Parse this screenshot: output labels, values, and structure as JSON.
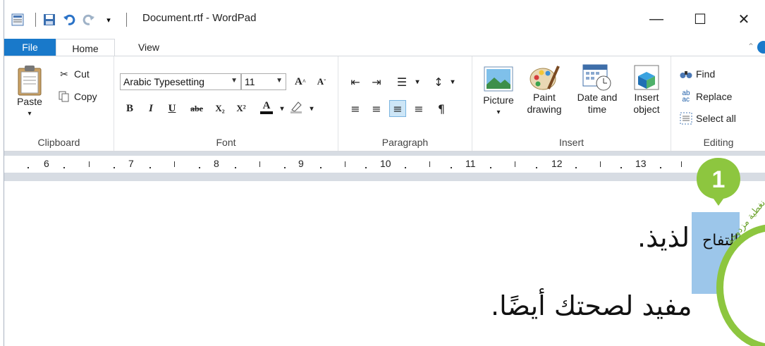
{
  "window": {
    "title": "Document.rtf - WordPad",
    "controls": {
      "minimize": "—",
      "maximize": "☐",
      "close": "✕"
    }
  },
  "tabs": [
    {
      "label": "File"
    },
    {
      "label": "Home"
    },
    {
      "label": "View"
    }
  ],
  "ribbon": {
    "clipboard": {
      "label": "Clipboard",
      "paste": "Paste",
      "cut": "Cut",
      "copy": "Copy"
    },
    "font": {
      "label": "Font",
      "family": "Arabic Typesetting",
      "size": "11",
      "bold": "B",
      "italic": "I",
      "underline": "U",
      "strike": "abe",
      "subscript": "X₂",
      "superscript": "X²"
    },
    "paragraph": {
      "label": "Paragraph"
    },
    "insert": {
      "label": "Insert",
      "picture": "Picture",
      "paint_drawing": "Paint drawing",
      "date_time": "Date and time",
      "insert_object": "Insert object"
    },
    "editing": {
      "label": "Editing",
      "find": "Find",
      "replace": "Replace",
      "select_all": "Select all"
    }
  },
  "ruler": {
    "numbers": [
      "6",
      "7",
      "8",
      "9",
      "10",
      "11",
      "12",
      "13"
    ]
  },
  "document": {
    "selected_word": "التفاح",
    "line1_rest": "لذيذ.",
    "line2": "مفيد لصحتك أيضًا."
  },
  "callout": {
    "number": "1",
    "color": "#8dc63f"
  },
  "sticker": {
    "text": "نغطية مزدوجة"
  },
  "colors": {
    "file_tab": "#1979ca",
    "selection": "#9cc6ea",
    "accent_green": "#8dc63f"
  }
}
